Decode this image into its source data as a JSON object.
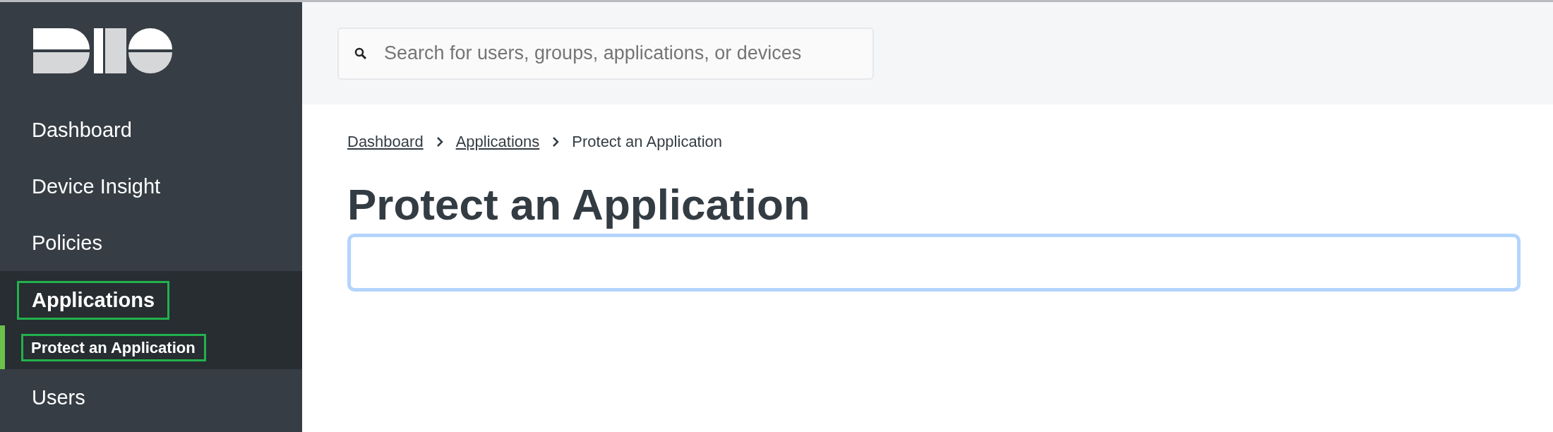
{
  "sidebar": {
    "items": [
      {
        "label": "Dashboard",
        "selected": false,
        "highlighted": false
      },
      {
        "label": "Device Insight",
        "selected": false,
        "highlighted": false
      },
      {
        "label": "Policies",
        "selected": false,
        "highlighted": false
      },
      {
        "label": "Applications",
        "selected": true,
        "highlighted": true,
        "expanded": true,
        "children": [
          {
            "label": "Protect an Application",
            "selected": true,
            "highlighted": true
          }
        ]
      },
      {
        "label": "Users",
        "selected": false,
        "highlighted": false
      }
    ]
  },
  "search": {
    "placeholder": "Search for users, groups, applications, or devices"
  },
  "breadcrumb": [
    {
      "label": "Dashboard",
      "link": true
    },
    {
      "label": "Applications",
      "link": true
    },
    {
      "label": "Protect an Application",
      "link": false
    }
  ],
  "page_title": "Protect an Application",
  "filter": {
    "focused": true
  }
}
